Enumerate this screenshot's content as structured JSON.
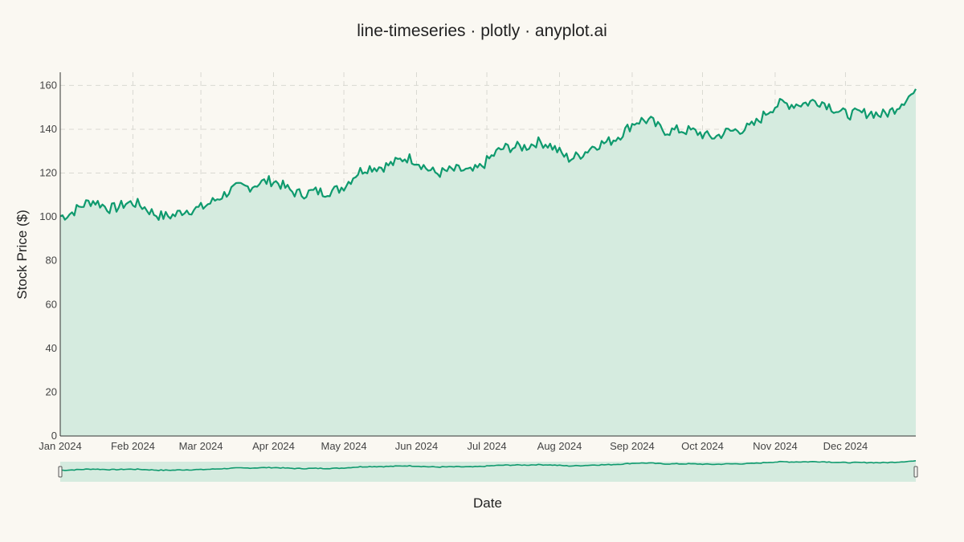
{
  "chart_data": {
    "type": "line",
    "title": "line-timeseries · plotly · anyplot.ai",
    "xlabel": "Date",
    "ylabel": "Stock Price ($)",
    "xlim": [
      "2024-01-01",
      "2024-12-31"
    ],
    "ylim": [
      0,
      166
    ],
    "yticks": [
      0,
      20,
      40,
      60,
      80,
      100,
      120,
      140,
      160
    ],
    "xticks": [
      {
        "date": "2024-01-01",
        "label": "Jan 2024"
      },
      {
        "date": "2024-02-01",
        "label": "Feb 2024"
      },
      {
        "date": "2024-03-01",
        "label": "Mar 2024"
      },
      {
        "date": "2024-04-01",
        "label": "Apr 2024"
      },
      {
        "date": "2024-05-01",
        "label": "May 2024"
      },
      {
        "date": "2024-06-01",
        "label": "Jun 2024"
      },
      {
        "date": "2024-07-01",
        "label": "Jul 2024"
      },
      {
        "date": "2024-08-01",
        "label": "Aug 2024"
      },
      {
        "date": "2024-09-01",
        "label": "Sep 2024"
      },
      {
        "date": "2024-10-01",
        "label": "Oct 2024"
      },
      {
        "date": "2024-11-01",
        "label": "Nov 2024"
      },
      {
        "date": "2024-12-01",
        "label": "Dec 2024"
      }
    ],
    "grid": true,
    "fill_under_line": true,
    "range_slider": true,
    "colors": {
      "line": "#0f9a6e",
      "fill": "#d5ebdf",
      "background": "#faf8f2"
    },
    "series": [
      {
        "x": [
          "2024-01-01",
          "2024-01-08",
          "2024-01-15",
          "2024-01-22",
          "2024-01-29",
          "2024-02-05",
          "2024-02-12",
          "2024-02-19",
          "2024-02-26",
          "2024-03-04",
          "2024-03-11",
          "2024-03-18",
          "2024-03-25",
          "2024-04-01",
          "2024-04-08",
          "2024-04-15",
          "2024-04-22",
          "2024-04-29",
          "2024-05-06",
          "2024-05-13",
          "2024-05-20",
          "2024-05-27",
          "2024-06-03",
          "2024-06-10",
          "2024-06-17",
          "2024-06-24",
          "2024-07-01",
          "2024-07-08",
          "2024-07-15",
          "2024-07-22",
          "2024-07-29",
          "2024-08-05",
          "2024-08-12",
          "2024-08-19",
          "2024-08-26",
          "2024-09-02",
          "2024-09-09",
          "2024-09-16",
          "2024-09-23",
          "2024-09-30",
          "2024-10-07",
          "2024-10-14",
          "2024-10-21",
          "2024-10-28",
          "2024-11-04",
          "2024-11-11",
          "2024-11-18",
          "2024-11-25",
          "2024-12-02",
          "2024-12-09",
          "2024-12-16",
          "2024-12-23",
          "2024-12-30"
        ],
        "values": [
          101,
          104,
          106,
          105,
          106,
          104,
          102,
          100,
          103,
          107,
          109,
          114,
          116,
          115,
          113,
          111,
          110,
          114,
          119,
          122,
          125,
          126,
          124,
          121,
          120,
          121,
          126,
          130,
          133,
          134,
          131,
          128,
          129,
          133,
          138,
          142,
          144,
          140,
          138,
          139,
          137,
          138,
          142,
          147,
          151,
          153,
          152,
          150,
          148,
          146,
          147,
          151,
          155
        ]
      }
    ]
  }
}
